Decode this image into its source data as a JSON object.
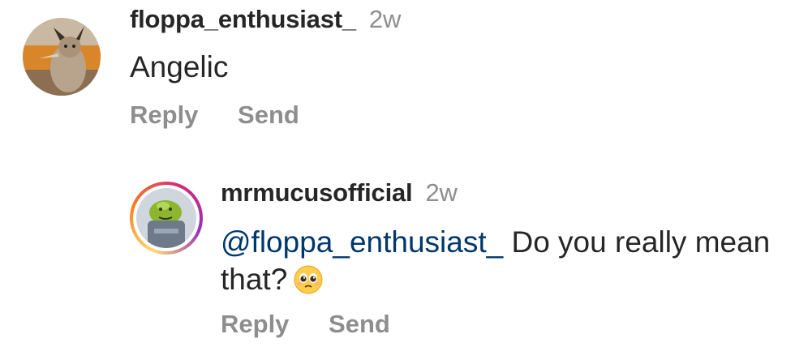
{
  "comments": [
    {
      "username": "floppa_enthusiast_",
      "age": "2w",
      "text": "Angelic",
      "reply_label": "Reply",
      "send_label": "Send",
      "avatar": "caracal-avatar"
    },
    {
      "username": "mrmucusofficial",
      "age": "2w",
      "mention": "@floppa_enthusiast_",
      "text_line1": " Do you really mean",
      "text_line2": "that?",
      "emoji": "pleading-face-emoji",
      "reply_label": "Reply",
      "send_label": "Send",
      "avatar": "mucus-mascot-avatar",
      "avatar_ring": [
        "#feda75",
        "#fa7e1e",
        "#d62976",
        "#962fbf"
      ]
    }
  ]
}
